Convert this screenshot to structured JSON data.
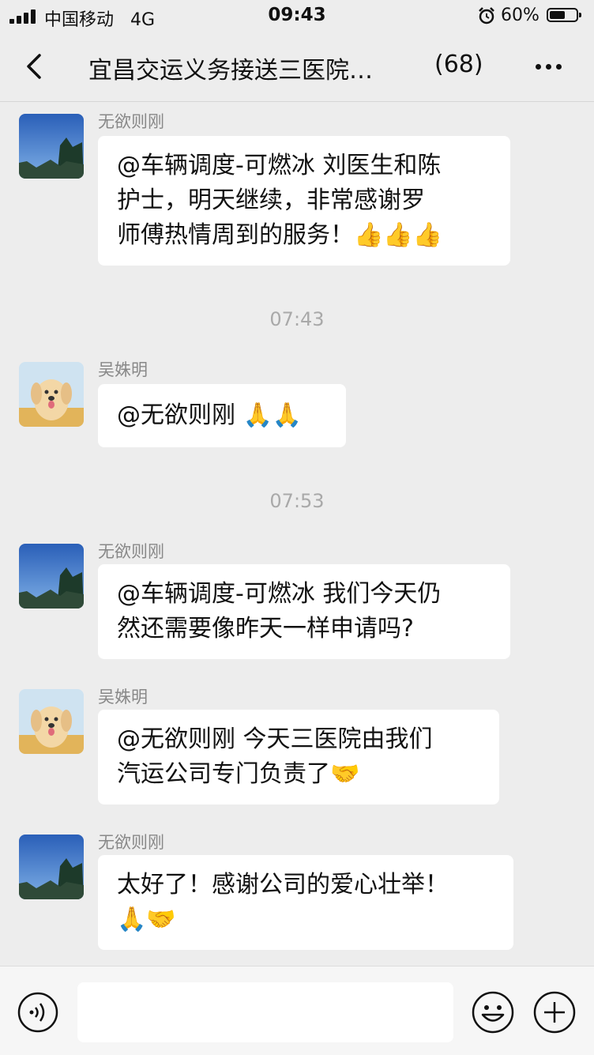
{
  "status_bar": {
    "carrier": "中国移动",
    "network": "4G",
    "time": "09:43",
    "battery": "60%",
    "battery_level": 0.6
  },
  "header": {
    "title": "宜昌交运义务接送三医院…",
    "member_count": "(68)"
  },
  "messages": [
    {
      "sender": "无欲则刚",
      "avatar": "tree-sky-avatar",
      "lines": [
        "@车辆调度-可燃冰 刘医生和陈",
        "护士，明天继续，非常感谢罗",
        "师傅热情周到的服务！👍👍👍"
      ]
    },
    {
      "timestamp": "07:43"
    },
    {
      "sender": "吴姝明",
      "avatar": "golden-retriever-avatar",
      "lines": [
        "@无欲则刚 🙏🙏"
      ]
    },
    {
      "timestamp": "07:53"
    },
    {
      "sender": "无欲则刚",
      "avatar": "tree-sky-avatar",
      "lines": [
        "@车辆调度-可燃冰 我们今天仍",
        "然还需要像昨天一样申请吗?"
      ]
    },
    {
      "sender": "吴姝明",
      "avatar": "golden-retriever-avatar",
      "lines": [
        "@无欲则刚 今天三医院由我们",
        "汽运公司专门负责了🤝"
      ]
    },
    {
      "sender": "无欲则刚",
      "avatar": "tree-sky-avatar",
      "lines": [
        "太好了！感谢公司的爱心壮举！",
        "🙏🤝"
      ]
    }
  ],
  "icons": {
    "back": "chevron-left-icon",
    "more": "more-dots-icon",
    "voice": "voice-icon",
    "emoji": "emoji-icon",
    "plus": "plus-icon"
  },
  "colors": {
    "background": "#ededed",
    "bubble": "#ffffff",
    "timestamp": "#a9a9a9",
    "sender": "#888888"
  }
}
